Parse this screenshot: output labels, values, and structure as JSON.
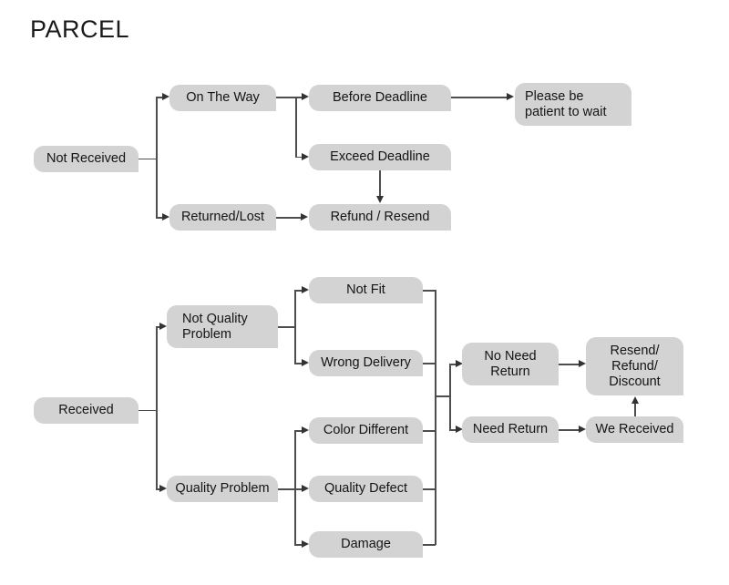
{
  "title": "PARCEL",
  "colors": {
    "node_fill": "#d3d3d3",
    "node_text": "#141414",
    "connector": "#4d4d4d",
    "arrowhead": "#333333",
    "background": "#ffffff"
  },
  "branches": {
    "not_received": {
      "root": "Not Received",
      "children": [
        "On The Way",
        "Returned/Lost"
      ],
      "on_the_way_children": [
        "Before Deadline",
        "Exceed Deadline"
      ],
      "outcomes": [
        "Please be\npatient to wait",
        "Refund / Resend"
      ]
    },
    "received": {
      "root": "Received",
      "children": [
        "Not Quality Problem",
        "Quality Problem"
      ],
      "not_quality_issues": [
        "Not Fit",
        "Wrong Delivery"
      ],
      "quality_issues": [
        "Color Different",
        "Quality Defect",
        "Damage"
      ],
      "return_decision": [
        "No Need Return",
        "Need Return"
      ],
      "resolutions": [
        "Resend/\nRefund/\nDiscount",
        "We Received"
      ]
    }
  },
  "nodes": {
    "not_received": "Not Received",
    "on_the_way": "On The Way",
    "returned_lost": "Returned/Lost",
    "before_deadline": "Before Deadline",
    "exceed_deadline": "Exceed Deadline",
    "please_be_patient": "Please be\npatient to wait",
    "refund_resend": "Refund / Resend",
    "received": "Received",
    "not_quality_problem": "Not Quality\nProblem",
    "quality_problem": "Quality Problem",
    "not_fit": "Not Fit",
    "wrong_delivery": "Wrong Delivery",
    "color_different": "Color Different",
    "quality_defect": "Quality Defect",
    "damage": "Damage",
    "no_need_return": "No Need\nReturn",
    "need_return": "Need Return",
    "resend_refund_discount": "Resend/\nRefund/\nDiscount",
    "we_received": "We Received"
  }
}
